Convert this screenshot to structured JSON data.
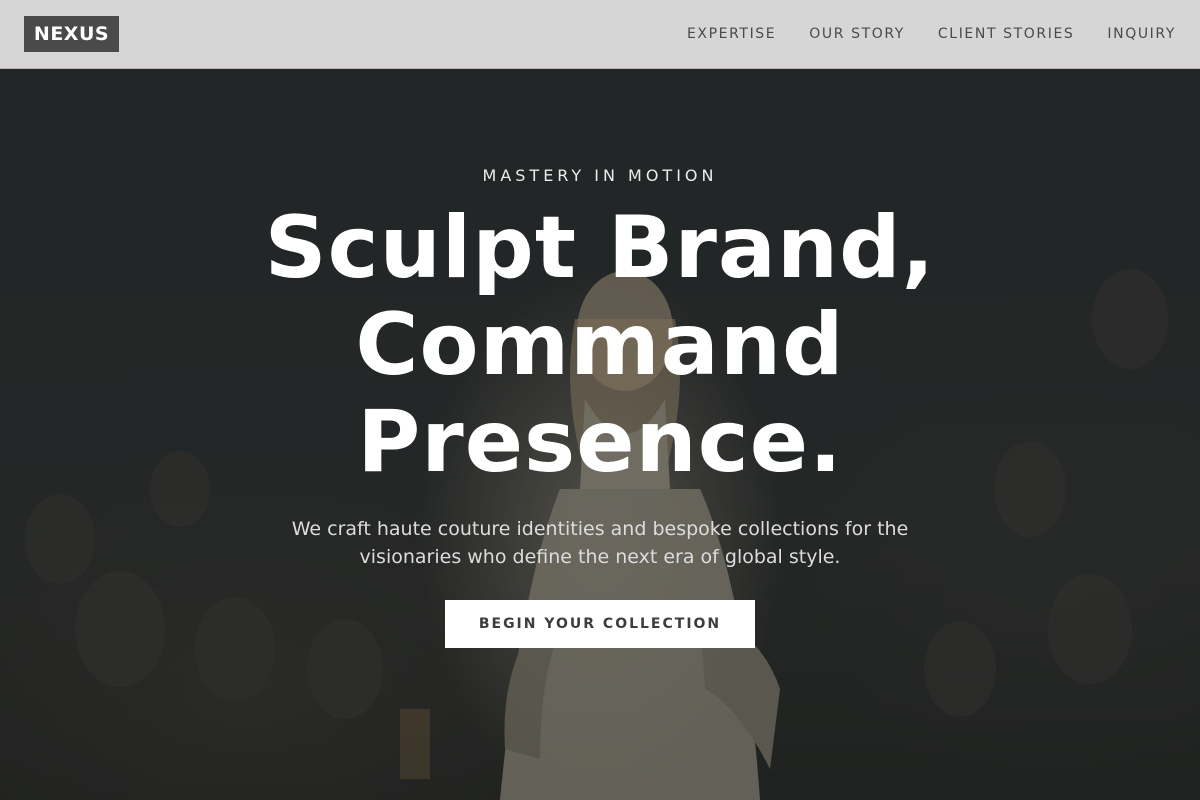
{
  "header": {
    "logo": "NEXUS",
    "nav": [
      {
        "label": "EXPERTISE"
      },
      {
        "label": "OUR STORY"
      },
      {
        "label": "CLIENT STORIES"
      },
      {
        "label": "INQUIRY"
      }
    ]
  },
  "hero": {
    "eyebrow": "MASTERY IN MOTION",
    "headline_lines": [
      "Sculpt Brand,",
      "Command",
      "Presence."
    ],
    "subtext": "We craft haute couture identities and bespoke collections for the visionaries who define the next era of global style.",
    "cta_label": "BEGIN YOUR COLLECTION",
    "image_subject": "runway-model-photo"
  },
  "colors": {
    "header_bg": "#d6d6d6",
    "logo_bg": "#4a4a4a",
    "hero_bg": "#2a2d2e",
    "cta_bg": "#ffffff"
  }
}
